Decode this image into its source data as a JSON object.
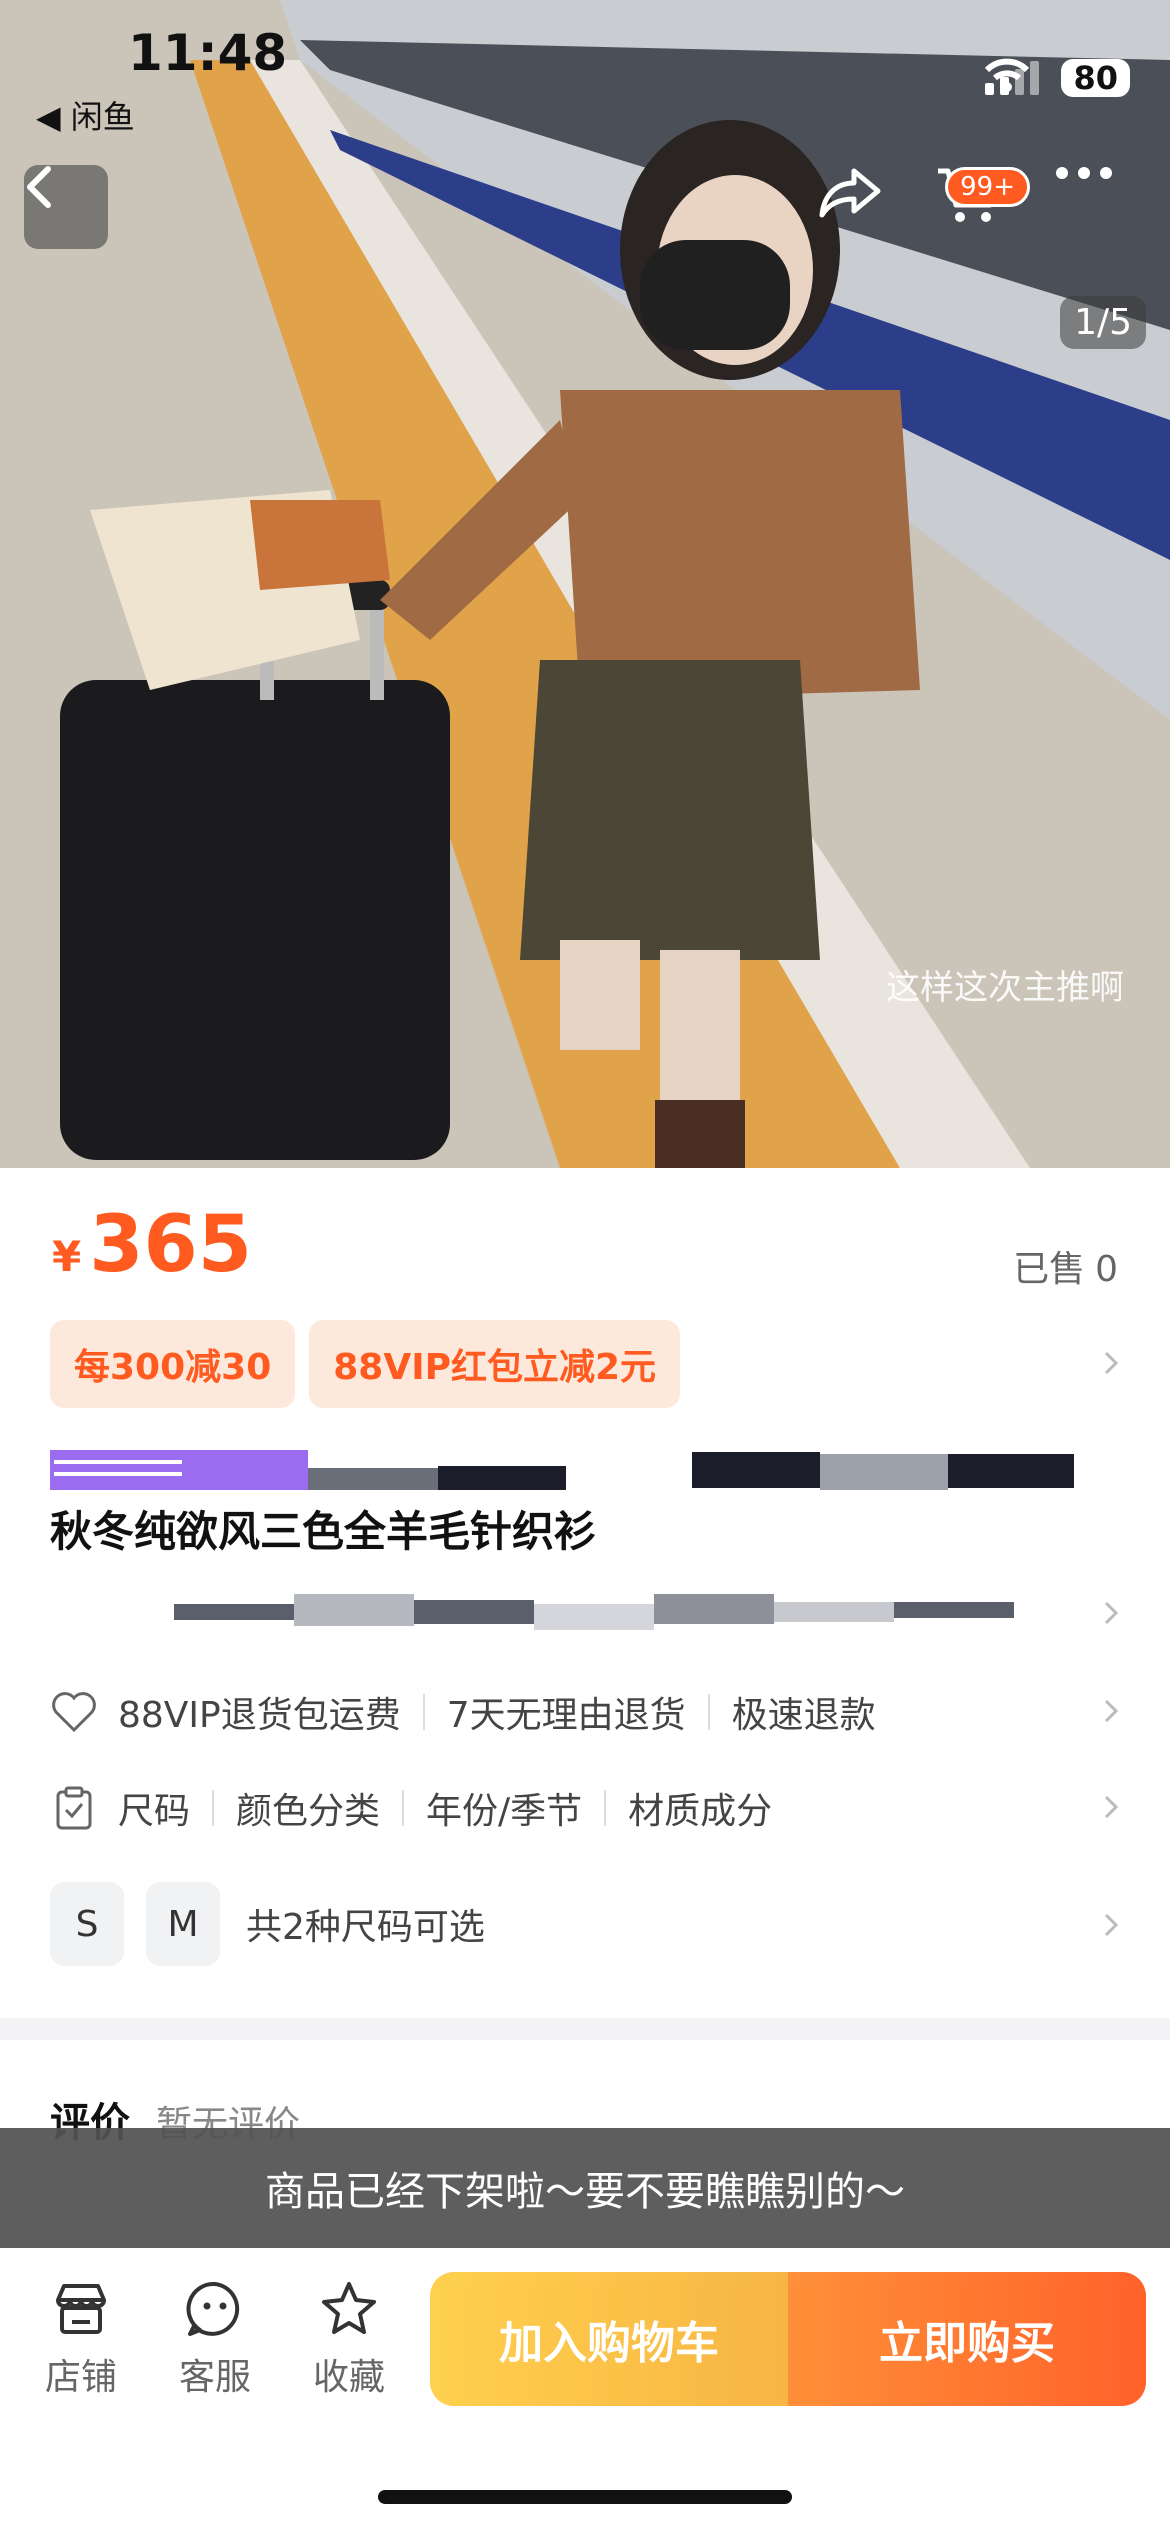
{
  "status_bar": {
    "time": "11:48",
    "back_app": "闲鱼",
    "battery": "80"
  },
  "nav": {
    "cart_badge": "99+",
    "photo_counter": "1/5"
  },
  "photo": {
    "watermark": "这样这次主推啊"
  },
  "price": {
    "currency": "¥",
    "amount": "365",
    "sold_label": "已售",
    "sold_count": "0"
  },
  "promos": [
    "每300减30",
    "88VIP红包立减2元"
  ],
  "product": {
    "title": "秋冬纯欲风三色全羊毛针织衫"
  },
  "services": [
    "88VIP退货包运费",
    "7天无理由退货",
    "极速退款"
  ],
  "params": [
    "尺码",
    "颜色分类",
    "年份/季节",
    "材质成分"
  ],
  "sizes": {
    "options": [
      "S",
      "M"
    ],
    "summary": "共2种尺码可选"
  },
  "reviews": {
    "title": "评价",
    "subtitle": "暂无评价"
  },
  "notice": "商品已经下架啦～要不要瞧瞧别的～",
  "bottom_bar": {
    "store": "店铺",
    "service": "客服",
    "favorite": "收藏",
    "add_to_cart": "加入购物车",
    "buy_now": "立即购买"
  },
  "colors": {
    "accent": "#ff5a1f",
    "cart_button": "#f9bd3f",
    "promo_bg": "#fde9dc"
  }
}
